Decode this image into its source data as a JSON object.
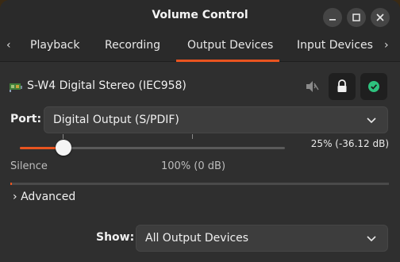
{
  "window": {
    "title": "Volume Control"
  },
  "tabs": {
    "items": [
      {
        "label": "Playback"
      },
      {
        "label": "Recording"
      },
      {
        "label": "Output Devices"
      },
      {
        "label": "Input Devices"
      }
    ],
    "active": "Output Devices",
    "prev_arrow": "‹",
    "next_arrow": "›"
  },
  "device": {
    "name": "S-W4 Digital Stereo (IEC958)",
    "icon": "sound-card-icon",
    "mute_icon": "speaker-muted-icon",
    "lock_icon": "lock-icon",
    "default_icon": "check-circle-icon",
    "default_color": "#2ec27e"
  },
  "port": {
    "label": "Port:",
    "value": "Digital Output (S/PDIF)"
  },
  "volume": {
    "readout": "25% (-36.12 dB)",
    "fraction": 0.165,
    "silence_label": "Silence",
    "hundred_label": "100% (0 dB)",
    "peak_fraction": 0.0
  },
  "advanced": {
    "label": "Advanced",
    "arrow": "›"
  },
  "show": {
    "label": "Show:",
    "value": "All Output Devices"
  },
  "accent_color": "#e95420"
}
